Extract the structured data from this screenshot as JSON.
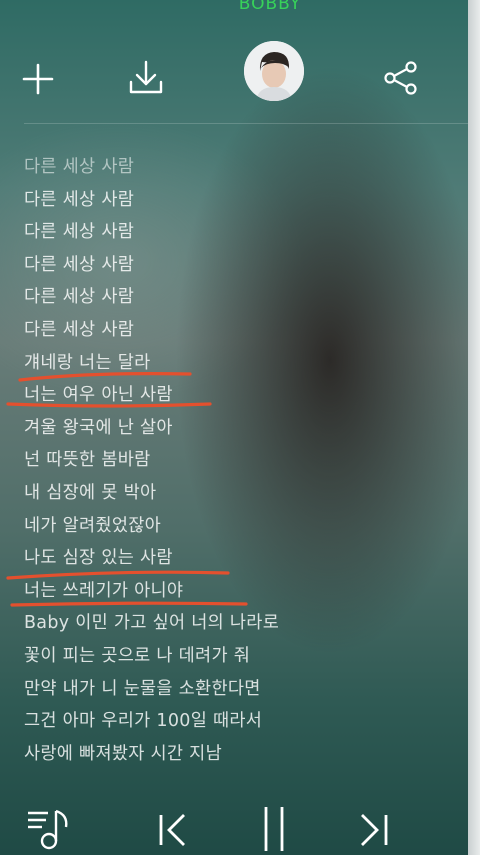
{
  "header": {
    "artist": "BOBBY"
  },
  "icons": {
    "add": "plus-icon",
    "download": "download-icon",
    "share": "share-icon",
    "playlist": "playlist-music-icon",
    "previous": "previous-track-icon",
    "pause": "pause-icon",
    "next": "next-track-icon"
  },
  "lyrics": [
    "다른 세상 사람",
    "다른 세상 사람",
    "다른 세상 사람",
    "다른 세상 사람",
    "다른 세상 사람",
    "다른 세상 사람",
    "걔네랑 너는 달라",
    "너는 여우 아닌 사람",
    "겨울 왕국에 난 살아",
    "넌 따뜻한 봄바람",
    "내 심장에 못 박아",
    "네가 알려줬었잖아",
    "나도 심장 있는 사람",
    "너는 쓰레기가 아니야",
    "Baby 이민 가고 싶어 너의 나라로",
    "꽃이 피는 곳으로 나 데려가 줘",
    "만약 내가 니 눈물을 소환한다면",
    "그건 아마 우리가 100일 때라서",
    "사랑에 빠져봤자 시간 지남"
  ],
  "colors": {
    "artist": "#37d25a",
    "annotation": "#e4502e"
  }
}
